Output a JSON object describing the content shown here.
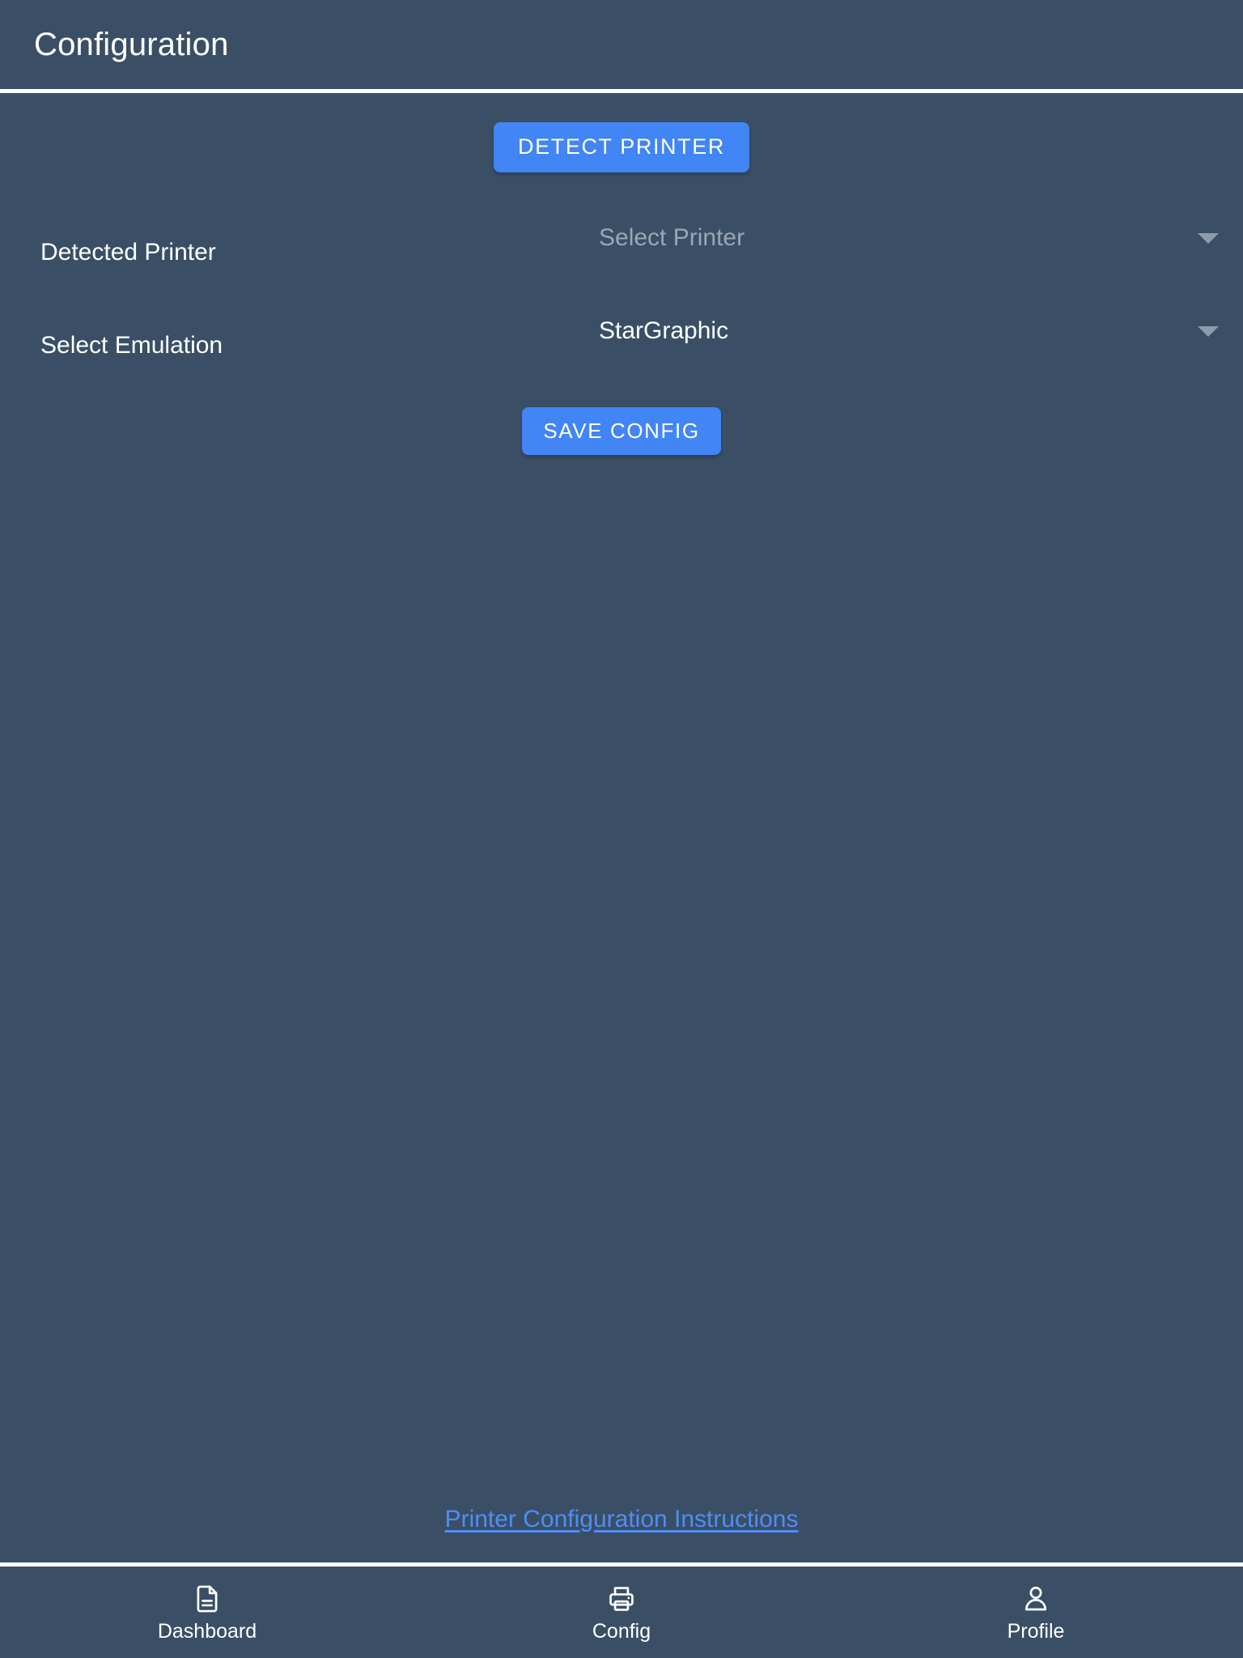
{
  "header": {
    "title": "Configuration"
  },
  "main": {
    "detect_button": {
      "label": "DETECT PRINTER",
      "icon": "none",
      "color": "#4285f4"
    },
    "fields": [
      {
        "label": "Detected Printer",
        "value": "",
        "placeholder": "Select Printer",
        "is_placeholder": true,
        "caret_icon": "chevron-down-icon"
      },
      {
        "label": "Select Emulation",
        "value": "StarGraphic",
        "placeholder": "",
        "is_placeholder": false,
        "caret_icon": "chevron-down-icon"
      }
    ],
    "save_button": {
      "label": "SAVE CONFIG",
      "color": "#4285f4"
    },
    "footer_link": {
      "label": "Printer Configuration Instructions",
      "color": "#4f8df6"
    }
  },
  "bottom_nav": {
    "items": [
      {
        "label": "Dashboard",
        "icon": "document-icon",
        "active": false
      },
      {
        "label": "Config",
        "icon": "printer-icon",
        "active": true
      },
      {
        "label": "Profile",
        "icon": "person-icon",
        "active": false
      }
    ]
  },
  "theme": {
    "background": "#3a4f66",
    "accent": "#4285f4",
    "link": "#4f8df6",
    "text": "#ffffff",
    "placeholder_text": "#9aa6b4",
    "divider": "#ffffff"
  }
}
